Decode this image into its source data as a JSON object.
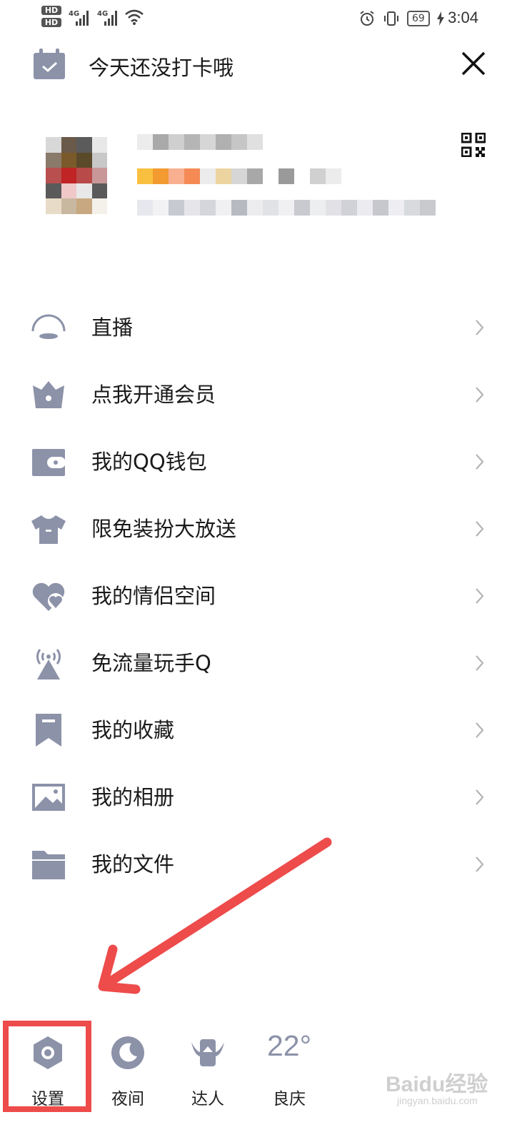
{
  "status_bar": {
    "hd1": "HD",
    "hd2": "HD",
    "net1": "4G",
    "net2": "4G",
    "battery": "69",
    "time": "3:04"
  },
  "header": {
    "title": "今天还没打卡哦",
    "calendar_icon": "calendar-check-icon",
    "close_icon": "close-icon"
  },
  "profile": {
    "qr_icon": "qr-code-icon"
  },
  "menu": {
    "items": [
      {
        "label": "直播",
        "icon": "live-icon"
      },
      {
        "label": "点我开通会员",
        "icon": "vip-crown-icon"
      },
      {
        "label": "我的QQ钱包",
        "icon": "wallet-icon"
      },
      {
        "label": "限免装扮大放送",
        "icon": "tshirt-icon"
      },
      {
        "label": "我的情侣空间",
        "icon": "couple-hearts-icon"
      },
      {
        "label": "免流量玩手Q",
        "icon": "antenna-icon"
      },
      {
        "label": "我的收藏",
        "icon": "bookmark-icon"
      },
      {
        "label": "我的相册",
        "icon": "photo-icon"
      },
      {
        "label": "我的文件",
        "icon": "folder-icon"
      }
    ]
  },
  "bottom_bar": {
    "settings_label": "设置",
    "night_label": "夜间",
    "expert_label": "达人",
    "temperature": "22°",
    "weather_label": "良庆"
  },
  "watermark": {
    "brand": "Baidu经验",
    "url": "jingyan.baidu.com"
  },
  "colors": {
    "icon_gray": "#8c92a8",
    "annotation_red": "#ee4b4b",
    "text": "#1a1a1a"
  }
}
